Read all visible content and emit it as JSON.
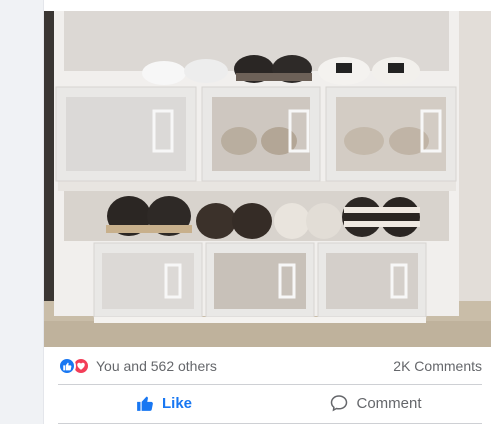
{
  "post": {
    "photo_alt": "Shoe organizer shelves with clear drawers"
  },
  "stats": {
    "reaction_text": "You and 562 others",
    "comments": "2K Comments"
  },
  "actions": {
    "like_label": "Like",
    "comment_label": "Comment"
  },
  "colors": {
    "like_blue": "#1877f2",
    "love_red": "#f33e58",
    "muted_text": "#65676b"
  }
}
